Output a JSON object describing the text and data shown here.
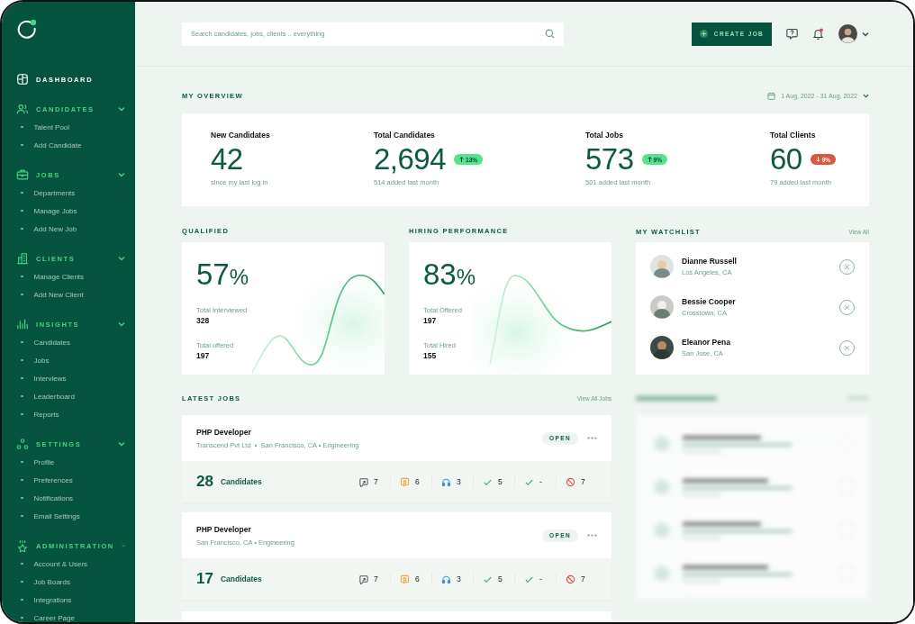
{
  "sidebar": {
    "sections": [
      {
        "label": "DASHBOARD",
        "selected": true
      },
      {
        "label": "CANDIDATES",
        "selected": false,
        "expanded": true,
        "items": [
          "Talent Pool",
          "Add Candidate"
        ]
      },
      {
        "label": "JOBS",
        "selected": false,
        "expanded": true,
        "items": [
          "Departments",
          "Manage Jobs",
          "Add New Job"
        ]
      },
      {
        "label": "CLIENTS",
        "selected": false,
        "expanded": true,
        "items": [
          "Manage Clients",
          "Add New Client"
        ]
      },
      {
        "label": "INSIGHTS",
        "selected": false,
        "expanded": true,
        "items": [
          "Candidates",
          "Jobs",
          "Interviews",
          "Leaderboard",
          "Reports"
        ]
      },
      {
        "label": "SETTINGS",
        "selected": false,
        "expanded": true,
        "items": [
          "Profile",
          "Preferences",
          "Notifications",
          "Email Settings"
        ]
      },
      {
        "label": "ADMINISTRATION",
        "selected": false,
        "expanded": true,
        "items": [
          "Account & Users",
          "Job Boards",
          "Integrations",
          "Career Page"
        ]
      }
    ]
  },
  "header": {
    "search": {
      "placeholder": "Search candidates, jobs, clients .. everything"
    },
    "create_button": "CREATE JOB",
    "notifications": {
      "unread": true
    }
  },
  "overview": {
    "title": "MY OVERVIEW",
    "date_range": "1 Aug, 2022 - 31 Aug, 2022",
    "stats": [
      {
        "label": "New Candidates",
        "value": "42",
        "note": "since my last log in"
      },
      {
        "label": "Total Candidates",
        "value": "2,694",
        "badge": {
          "text": "13%",
          "increase": true
        },
        "note": "514 added last month"
      },
      {
        "label": "Total Jobs",
        "value": "573",
        "badge": {
          "text": "9%",
          "increase": true
        },
        "note": "501 added last month"
      },
      {
        "label": "Total Clients",
        "value": "60",
        "badge": {
          "text": "9%",
          "increase": false
        },
        "note": "79 added last month"
      }
    ]
  },
  "performance_cards": [
    {
      "title": "QUALIFIED",
      "value": "57",
      "unit": "%",
      "metrics": [
        {
          "label": "Total Interviewed",
          "value": "328"
        },
        {
          "label": "Total offered",
          "value": "197"
        }
      ]
    },
    {
      "title": "HIRING PERFORMANCE",
      "value": "83",
      "unit": "%",
      "metrics": [
        {
          "label": "Total Offered",
          "value": "197"
        },
        {
          "label": "Total Hired",
          "value": "155"
        }
      ]
    }
  ],
  "watchlist": {
    "title": "MY WATCHLIST",
    "link": "View All",
    "people": [
      {
        "name": "Dianne Russell",
        "location": "Los Angeles, CA"
      },
      {
        "name": "Bessie Cooper",
        "location": "Crosstown, CA"
      },
      {
        "name": "Eleanor Pena",
        "location": "San Jose, CA"
      }
    ]
  },
  "latest_jobs": {
    "title": "LATEST JOBS",
    "link": "View All Jobs",
    "jobs": [
      {
        "title": "PHP Developer",
        "meta": "Transcend Pvt Ltd  •  San Francisco, CA • Engineering",
        "status": "OPEN",
        "count": "28",
        "count_label": "Candidates",
        "stats": [
          "7",
          "6",
          "3",
          "5",
          "-",
          "7"
        ]
      },
      {
        "title": "PHP Developer",
        "meta": "San Francisco, CA • Engineering",
        "status": "OPEN",
        "count": "17",
        "count_label": "Candidates",
        "stats": [
          "7",
          "6",
          "3",
          "5",
          "-",
          "7"
        ]
      }
    ]
  }
}
